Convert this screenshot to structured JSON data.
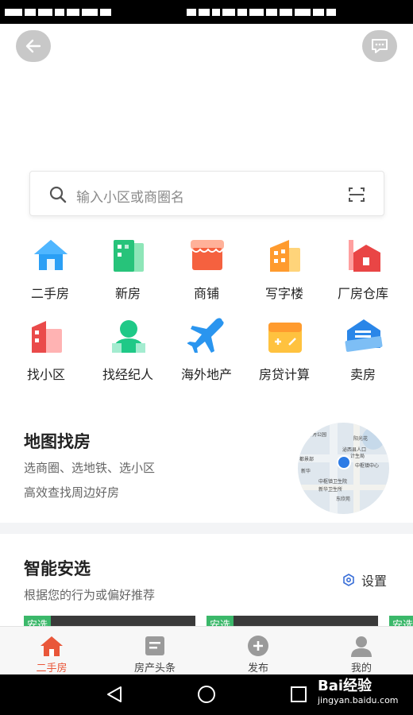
{
  "search": {
    "placeholder": "输入小区或商圈名"
  },
  "grid": {
    "row1": [
      {
        "label": "二手房",
        "icon": "house-icon"
      },
      {
        "label": "新房",
        "icon": "building-icon"
      },
      {
        "label": "商铺",
        "icon": "shop-icon"
      },
      {
        "label": "写字楼",
        "icon": "office-icon"
      },
      {
        "label": "厂房仓库",
        "icon": "factory-icon"
      }
    ],
    "row2": [
      {
        "label": "找小区",
        "icon": "community-icon"
      },
      {
        "label": "找经纪人",
        "icon": "agent-icon"
      },
      {
        "label": "海外地产",
        "icon": "airplane-icon"
      },
      {
        "label": "房贷计算",
        "icon": "calculator-icon"
      },
      {
        "label": "卖房",
        "icon": "sell-house-icon"
      }
    ]
  },
  "map_section": {
    "title": "地图找房",
    "line1": "选商圈、选地铁、选小区",
    "line2": "高效查找周边好房",
    "map_labels": [
      "阳光花",
      "竹秀公园",
      "泌西县人口",
      "计生局",
      "中枢镇中心",
      "新华",
      "中枢镇卫生院",
      "新华卫生所",
      "东欣苑",
      "都景部"
    ]
  },
  "smart_section": {
    "title": "智能安选",
    "subtitle": "根据您的行为或偏好推荐",
    "settings_label": "设置",
    "card_tag": "安选"
  },
  "tabbar": {
    "tabs": [
      {
        "label": "二手房",
        "icon": "home-icon",
        "active": true
      },
      {
        "label": "房产头条",
        "icon": "news-icon",
        "active": false
      },
      {
        "label": "发布",
        "icon": "plus-circle-icon",
        "active": false
      },
      {
        "label": "我的",
        "icon": "profile-icon",
        "active": false
      }
    ]
  },
  "watermark": {
    "brand": "Bai经验",
    "url": "jingyan.baidu.com"
  },
  "colors": {
    "accent": "#e9573a",
    "green_tag": "#3bb86a"
  }
}
